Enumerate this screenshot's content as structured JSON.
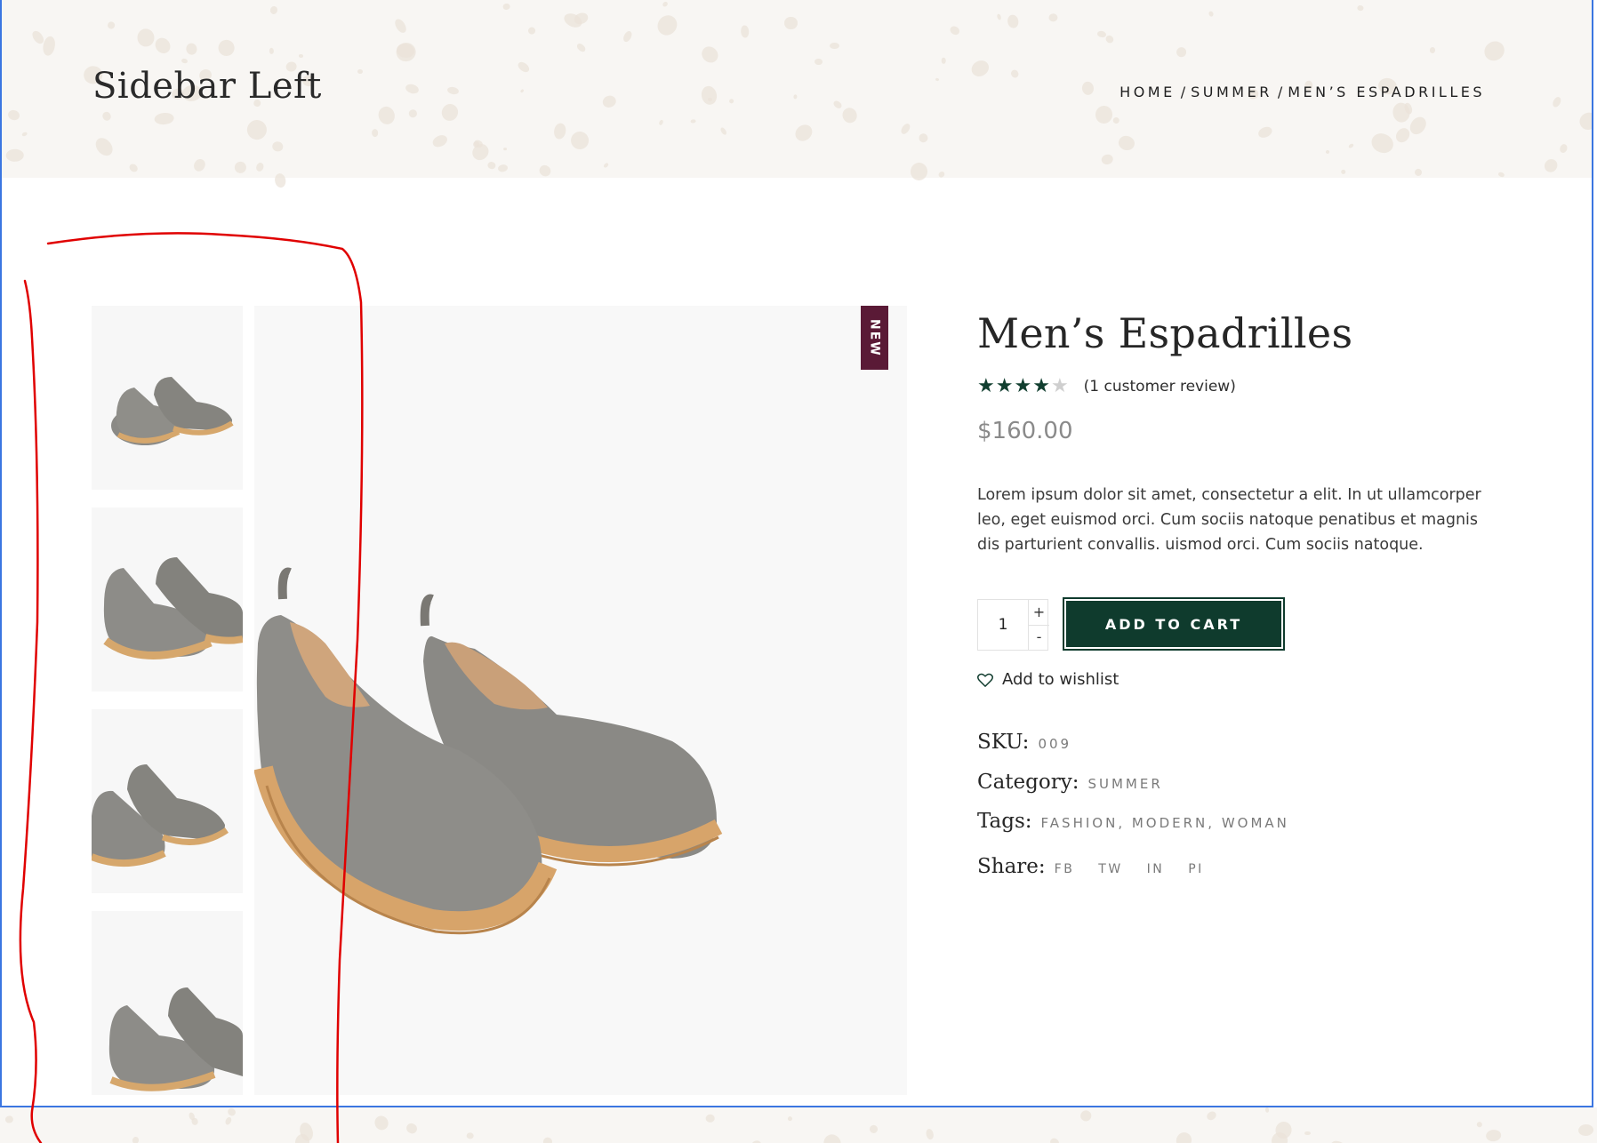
{
  "header": {
    "page_title": "Sidebar Left",
    "breadcrumb": {
      "home": "HOME",
      "category": "SUMMER",
      "current": "MEN’S ESPADRILLES",
      "separator": "/"
    }
  },
  "gallery": {
    "badge": "NEW",
    "thumbnails": [
      "espadrilles-thumb-1",
      "espadrilles-thumb-2",
      "espadrilles-thumb-3",
      "espadrilles-thumb-4"
    ]
  },
  "product": {
    "title": "Men’s Espadrilles",
    "rating": 4,
    "rating_max": 5,
    "review_text": "(1 customer review)",
    "price": "$160.00",
    "description": "Lorem ipsum dolor sit amet, consectetur a elit. In ut ullamcorper leo, eget euismod orci. Cum sociis natoque penatibus et magnis dis parturient convallis. uismod orci. Cum sociis natoque.",
    "quantity": "1",
    "qty_plus": "+",
    "qty_minus": "-",
    "add_to_cart": "ADD TO CART",
    "wishlist": "Add to wishlist",
    "sku_label": "SKU:",
    "sku_value": "009",
    "category_label": "Category:",
    "category_value": "SUMMER",
    "tags_label": "Tags:",
    "tags": [
      "FASHION",
      "MODERN",
      "WOMAN"
    ],
    "share_label": "Share:",
    "share": [
      "FB",
      "TW",
      "IN",
      "PI"
    ]
  },
  "colors": {
    "accent": "#0f3b2d",
    "badge": "#5a1a36",
    "header_bg": "#f8f6f3",
    "frame_border": "#3b76e1",
    "annotation": "#e00000"
  }
}
